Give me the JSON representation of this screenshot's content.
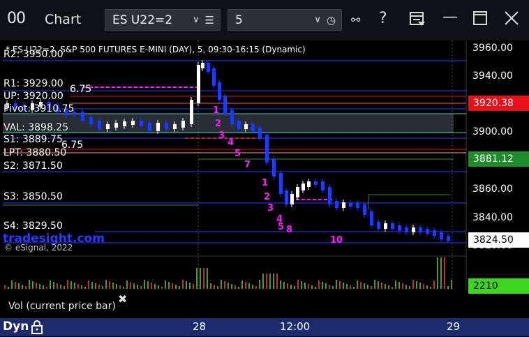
{
  "window": {
    "logo": "00",
    "title": "Chart",
    "symbol": "ES U22=2",
    "interval": "5",
    "buttons": [
      "link",
      "help",
      "layout",
      "minimize",
      "maximize",
      "close"
    ]
  },
  "chart": {
    "header": "* ES U22=2, S&P 500 FUTURES E-MINI (DAY), 5, 09:30-16:15 (Dynamic)",
    "watermark": "tradesight.com",
    "copyright": "© eSignal, 2022",
    "price_axis": [
      "3960.00",
      "3940.00",
      "3920.00",
      "3900.00",
      "3880.00",
      "3860.00",
      "3840.00",
      "3820.00"
    ],
    "last_prices": [
      {
        "value": "3920.38",
        "bg": "#e8101a",
        "fg": "#ffffff"
      },
      {
        "value": "3881.12",
        "bg": "#1d8c2a",
        "fg": "#ffffff"
      },
      {
        "value": "3824.50",
        "bg": "#ffffff",
        "fg": "#000000"
      }
    ],
    "levels": [
      {
        "label": "R2: 3950.00"
      },
      {
        "label": "R1: 3929.00"
      },
      {
        "label": "UP: 3920.00"
      },
      {
        "label": "Pivot: 3910.75"
      },
      {
        "label": "VAL: 3898.25"
      },
      {
        "label": "S1: 3889.75"
      },
      {
        "label": "LPT: 3880.50"
      },
      {
        "label": "S2: 3871.50"
      },
      {
        "label": "S3: 3850.50"
      },
      {
        "label": "S4: 3829.50"
      }
    ],
    "partial_labels": [
      "6.75",
      "6.75"
    ],
    "count_labels": [
      "1",
      "2",
      "3",
      "4",
      "5",
      "7",
      "1",
      "2",
      "3",
      "4",
      "5",
      "8",
      "10"
    ],
    "volume": {
      "label": "Vol (current price bar)",
      "value": "2210",
      "value_bg": "#3cd61e"
    },
    "x_axis": [
      "28",
      "12:00",
      "29"
    ]
  },
  "statusbar": {
    "label": "Dyn"
  },
  "colors": {
    "up_candle": "#ffffff",
    "down_candle": "#1a3cff",
    "pivot_blue": "#2a3cff",
    "magenta": "#ff1aff",
    "green_count": "#2a9a2a"
  }
}
